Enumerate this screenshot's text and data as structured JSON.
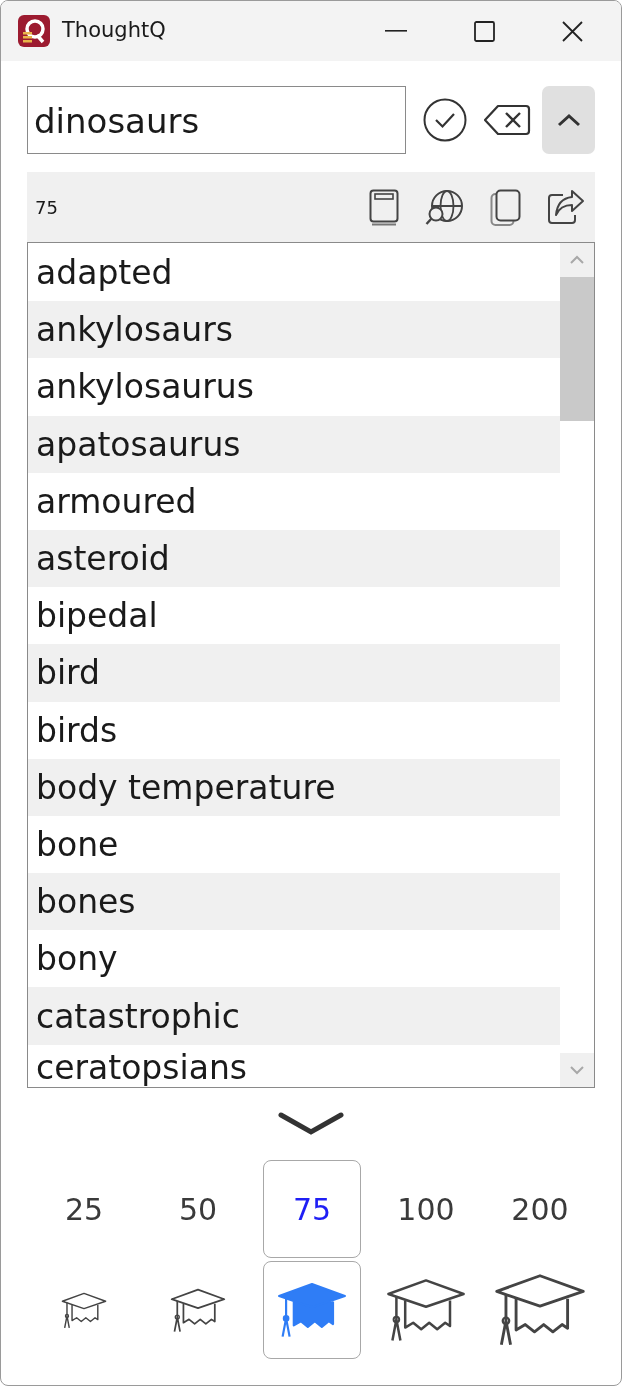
{
  "window": {
    "title": "ThoughtQ"
  },
  "search": {
    "value": "dinosaurs"
  },
  "toolbar": {
    "count": "75"
  },
  "word_list": {
    "items": [
      "adapted",
      "ankylosaurs",
      "ankylosaurus",
      "apatosaurus",
      "armoured",
      "asteroid",
      "bipedal",
      "bird",
      "birds",
      "body temperature",
      "bone",
      "bones",
      "bony",
      "catastrophic",
      "ceratopsians"
    ]
  },
  "levels": [
    {
      "label": "25",
      "selected": false
    },
    {
      "label": "50",
      "selected": false
    },
    {
      "label": "75",
      "selected": true
    },
    {
      "label": "100",
      "selected": false
    },
    {
      "label": "200",
      "selected": false
    }
  ]
}
